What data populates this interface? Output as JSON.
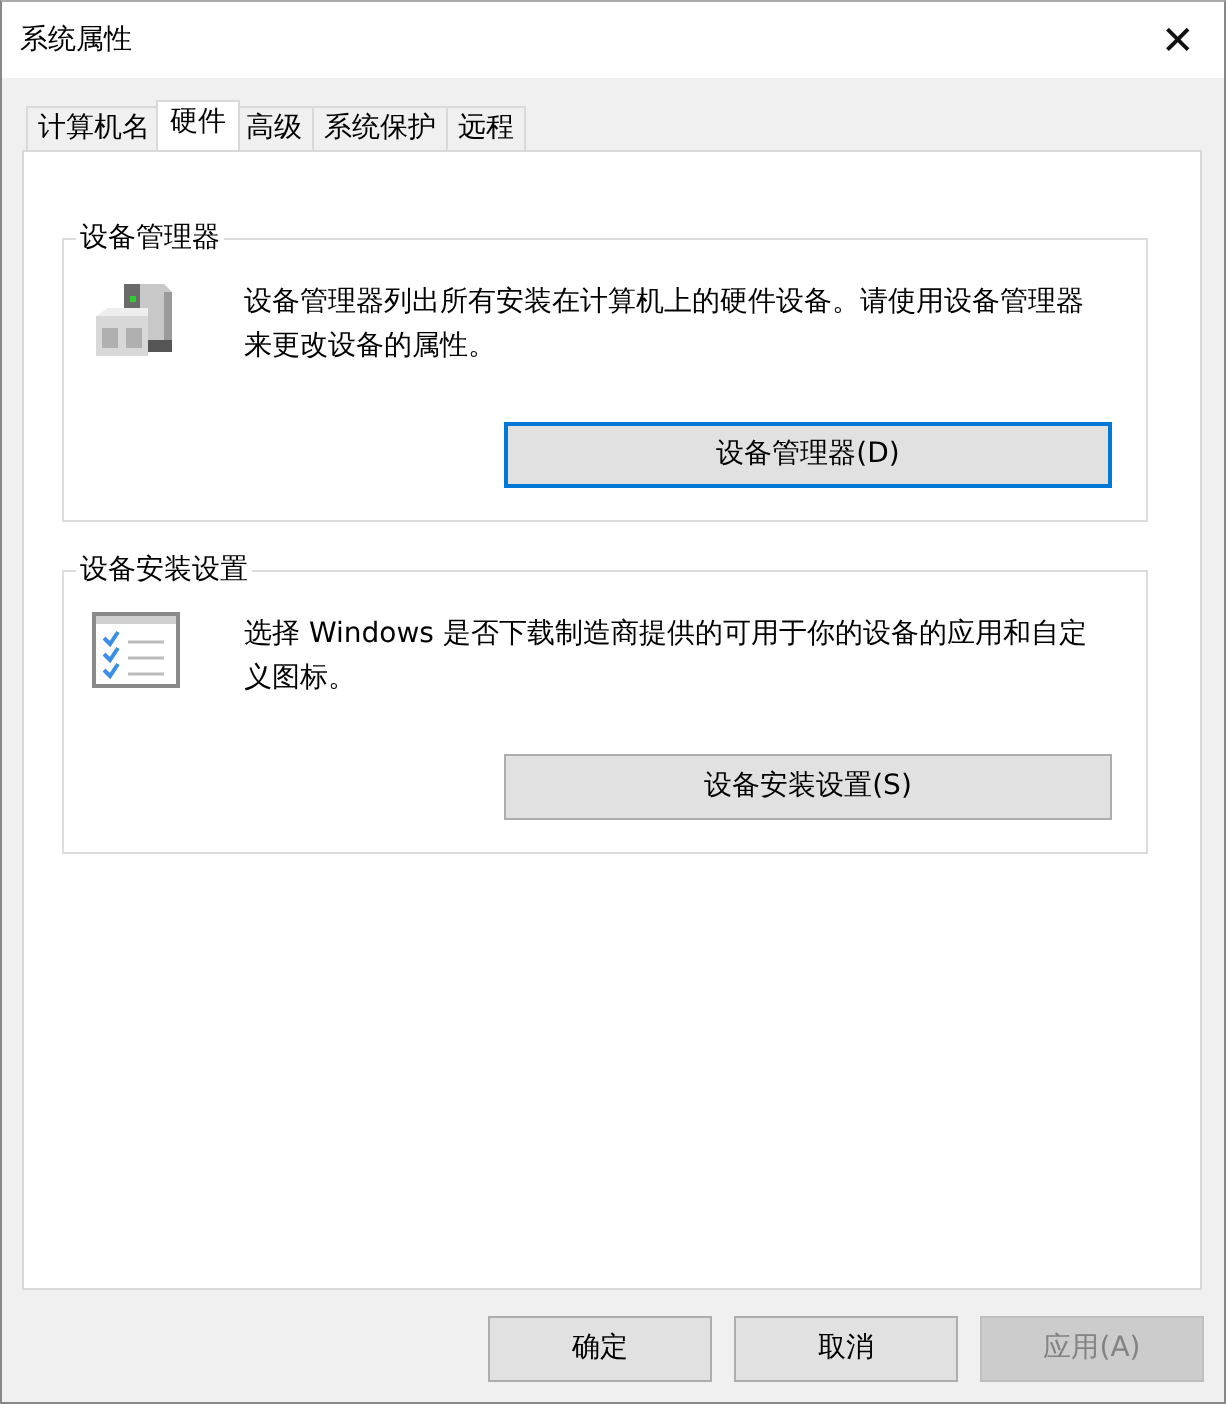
{
  "window": {
    "title": "系统属性",
    "close": "✕"
  },
  "tabs": [
    {
      "label": "计算机名",
      "selected": false
    },
    {
      "label": "硬件",
      "selected": true
    },
    {
      "label": "高级",
      "selected": false
    },
    {
      "label": "系统保护",
      "selected": false
    },
    {
      "label": "远程",
      "selected": false
    }
  ],
  "groups": [
    {
      "title": "设备管理器",
      "description": "设备管理器列出所有安装在计算机上的硬件设备。请使用设备管理器来更改设备的属性。",
      "button": {
        "label": "设备管理器(D)",
        "focused": true
      }
    },
    {
      "title": "设备安装设置",
      "description": "选择 Windows 是否下载制造商提供的可用于你的设备的应用和自定义图标。",
      "button": {
        "label": "设备安装设置(S)",
        "focused": false
      }
    }
  ],
  "buttons": [
    {
      "label": "确定",
      "disabled": false
    },
    {
      "label": "取消",
      "disabled": false
    },
    {
      "label": "应用(A)",
      "disabled": true
    }
  ]
}
